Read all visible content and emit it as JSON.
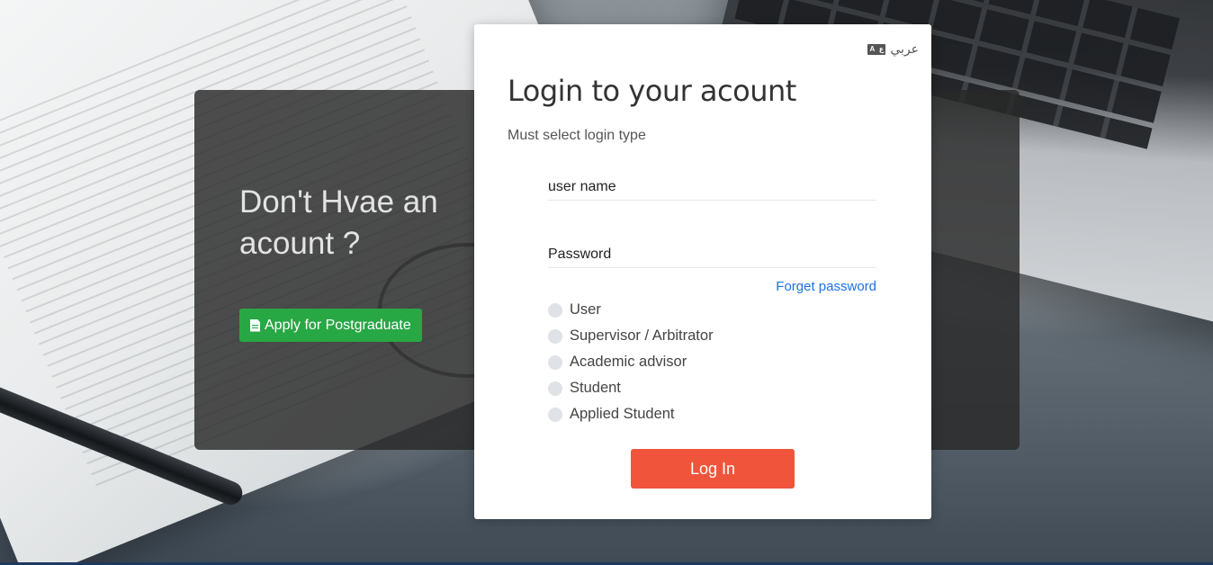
{
  "promo": {
    "title": "Don't Hvae an acount ?",
    "apply_button_label": "Apply for Postgraduate",
    "apply_icon": "file-text-icon"
  },
  "login": {
    "language_label": "عربي",
    "language_icon": "translate-icon",
    "title": "Login to your acount",
    "subtitle": "Must select login type",
    "username_placeholder": "user name",
    "password_placeholder": "Password",
    "forget_password_label": "Forget password",
    "login_types": [
      {
        "label": "User",
        "selected": false
      },
      {
        "label": "Supervisor / Arbitrator",
        "selected": false
      },
      {
        "label": "Academic advisor",
        "selected": false
      },
      {
        "label": "Student",
        "selected": false
      },
      {
        "label": "Applied Student",
        "selected": false
      }
    ],
    "login_button_label": "Log In"
  },
  "colors": {
    "apply_button": "#28a745",
    "login_button": "#f0553b",
    "link": "#1a73e8",
    "panel": "#282828"
  }
}
